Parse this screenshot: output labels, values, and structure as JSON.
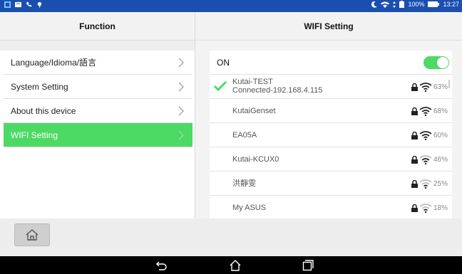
{
  "status_bar": {
    "battery": "100%",
    "time": "13:27"
  },
  "left_panel": {
    "title": "Function",
    "items": [
      {
        "label": "Language/Idioma/語言",
        "active": false
      },
      {
        "label": "System Setting",
        "active": false
      },
      {
        "label": "About this device",
        "active": false
      },
      {
        "label": "WIFI Setting",
        "active": true
      }
    ]
  },
  "right_panel": {
    "title": "WIFI Setting",
    "toggle_label": "ON",
    "toggle_on": true,
    "networks": [
      {
        "name": "Kutai-TEST",
        "status": "Connected-192.168.4.115",
        "signal": "63%",
        "connected": true,
        "locked": true
      },
      {
        "name": "KutaiGenset",
        "signal": "68%",
        "locked": true
      },
      {
        "name": "EA05A",
        "signal": "60%",
        "locked": true
      },
      {
        "name": "Kutai-KCUX0",
        "signal": "46%",
        "locked": true
      },
      {
        "name": "洪靜雯",
        "signal": "25%",
        "locked": true
      },
      {
        "name": "My ASUS",
        "signal": "18%",
        "locked": true
      }
    ]
  },
  "colors": {
    "status_bar": "#1a4fb0",
    "accent_green": "#4cd964",
    "nav_bar": "#000000"
  },
  "icons": [
    "home-icon",
    "back-icon",
    "nav-home-icon",
    "recents-icon",
    "chevron-right-icon",
    "lock-icon",
    "wifi-icon",
    "check-icon"
  ]
}
